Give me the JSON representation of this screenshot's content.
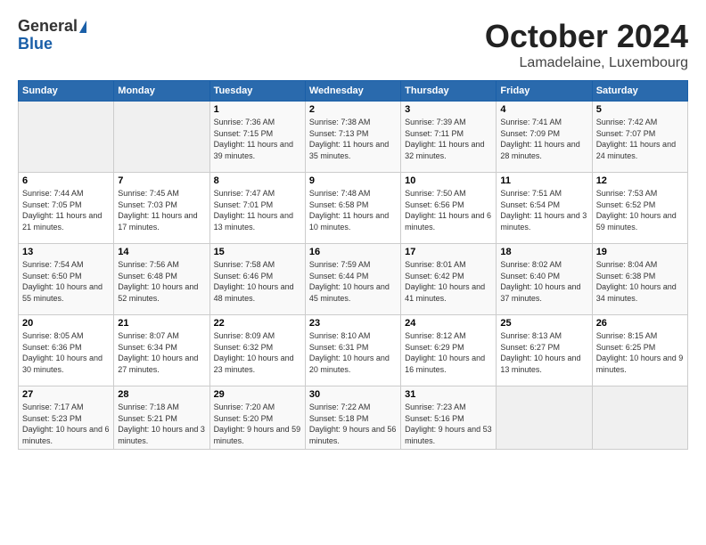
{
  "header": {
    "logo_general": "General",
    "logo_blue": "Blue",
    "month_title": "October 2024",
    "location": "Lamadelaine, Luxembourg"
  },
  "calendar": {
    "days_of_week": [
      "Sunday",
      "Monday",
      "Tuesday",
      "Wednesday",
      "Thursday",
      "Friday",
      "Saturday"
    ],
    "weeks": [
      [
        {
          "day": "",
          "info": ""
        },
        {
          "day": "",
          "info": ""
        },
        {
          "day": "1",
          "info": "Sunrise: 7:36 AM\nSunset: 7:15 PM\nDaylight: 11 hours and 39 minutes."
        },
        {
          "day": "2",
          "info": "Sunrise: 7:38 AM\nSunset: 7:13 PM\nDaylight: 11 hours and 35 minutes."
        },
        {
          "day": "3",
          "info": "Sunrise: 7:39 AM\nSunset: 7:11 PM\nDaylight: 11 hours and 32 minutes."
        },
        {
          "day": "4",
          "info": "Sunrise: 7:41 AM\nSunset: 7:09 PM\nDaylight: 11 hours and 28 minutes."
        },
        {
          "day": "5",
          "info": "Sunrise: 7:42 AM\nSunset: 7:07 PM\nDaylight: 11 hours and 24 minutes."
        }
      ],
      [
        {
          "day": "6",
          "info": "Sunrise: 7:44 AM\nSunset: 7:05 PM\nDaylight: 11 hours and 21 minutes."
        },
        {
          "day": "7",
          "info": "Sunrise: 7:45 AM\nSunset: 7:03 PM\nDaylight: 11 hours and 17 minutes."
        },
        {
          "day": "8",
          "info": "Sunrise: 7:47 AM\nSunset: 7:01 PM\nDaylight: 11 hours and 13 minutes."
        },
        {
          "day": "9",
          "info": "Sunrise: 7:48 AM\nSunset: 6:58 PM\nDaylight: 11 hours and 10 minutes."
        },
        {
          "day": "10",
          "info": "Sunrise: 7:50 AM\nSunset: 6:56 PM\nDaylight: 11 hours and 6 minutes."
        },
        {
          "day": "11",
          "info": "Sunrise: 7:51 AM\nSunset: 6:54 PM\nDaylight: 11 hours and 3 minutes."
        },
        {
          "day": "12",
          "info": "Sunrise: 7:53 AM\nSunset: 6:52 PM\nDaylight: 10 hours and 59 minutes."
        }
      ],
      [
        {
          "day": "13",
          "info": "Sunrise: 7:54 AM\nSunset: 6:50 PM\nDaylight: 10 hours and 55 minutes."
        },
        {
          "day": "14",
          "info": "Sunrise: 7:56 AM\nSunset: 6:48 PM\nDaylight: 10 hours and 52 minutes."
        },
        {
          "day": "15",
          "info": "Sunrise: 7:58 AM\nSunset: 6:46 PM\nDaylight: 10 hours and 48 minutes."
        },
        {
          "day": "16",
          "info": "Sunrise: 7:59 AM\nSunset: 6:44 PM\nDaylight: 10 hours and 45 minutes."
        },
        {
          "day": "17",
          "info": "Sunrise: 8:01 AM\nSunset: 6:42 PM\nDaylight: 10 hours and 41 minutes."
        },
        {
          "day": "18",
          "info": "Sunrise: 8:02 AM\nSunset: 6:40 PM\nDaylight: 10 hours and 37 minutes."
        },
        {
          "day": "19",
          "info": "Sunrise: 8:04 AM\nSunset: 6:38 PM\nDaylight: 10 hours and 34 minutes."
        }
      ],
      [
        {
          "day": "20",
          "info": "Sunrise: 8:05 AM\nSunset: 6:36 PM\nDaylight: 10 hours and 30 minutes."
        },
        {
          "day": "21",
          "info": "Sunrise: 8:07 AM\nSunset: 6:34 PM\nDaylight: 10 hours and 27 minutes."
        },
        {
          "day": "22",
          "info": "Sunrise: 8:09 AM\nSunset: 6:32 PM\nDaylight: 10 hours and 23 minutes."
        },
        {
          "day": "23",
          "info": "Sunrise: 8:10 AM\nSunset: 6:31 PM\nDaylight: 10 hours and 20 minutes."
        },
        {
          "day": "24",
          "info": "Sunrise: 8:12 AM\nSunset: 6:29 PM\nDaylight: 10 hours and 16 minutes."
        },
        {
          "day": "25",
          "info": "Sunrise: 8:13 AM\nSunset: 6:27 PM\nDaylight: 10 hours and 13 minutes."
        },
        {
          "day": "26",
          "info": "Sunrise: 8:15 AM\nSunset: 6:25 PM\nDaylight: 10 hours and 9 minutes."
        }
      ],
      [
        {
          "day": "27",
          "info": "Sunrise: 7:17 AM\nSunset: 5:23 PM\nDaylight: 10 hours and 6 minutes."
        },
        {
          "day": "28",
          "info": "Sunrise: 7:18 AM\nSunset: 5:21 PM\nDaylight: 10 hours and 3 minutes."
        },
        {
          "day": "29",
          "info": "Sunrise: 7:20 AM\nSunset: 5:20 PM\nDaylight: 9 hours and 59 minutes."
        },
        {
          "day": "30",
          "info": "Sunrise: 7:22 AM\nSunset: 5:18 PM\nDaylight: 9 hours and 56 minutes."
        },
        {
          "day": "31",
          "info": "Sunrise: 7:23 AM\nSunset: 5:16 PM\nDaylight: 9 hours and 53 minutes."
        },
        {
          "day": "",
          "info": ""
        },
        {
          "day": "",
          "info": ""
        }
      ]
    ]
  }
}
